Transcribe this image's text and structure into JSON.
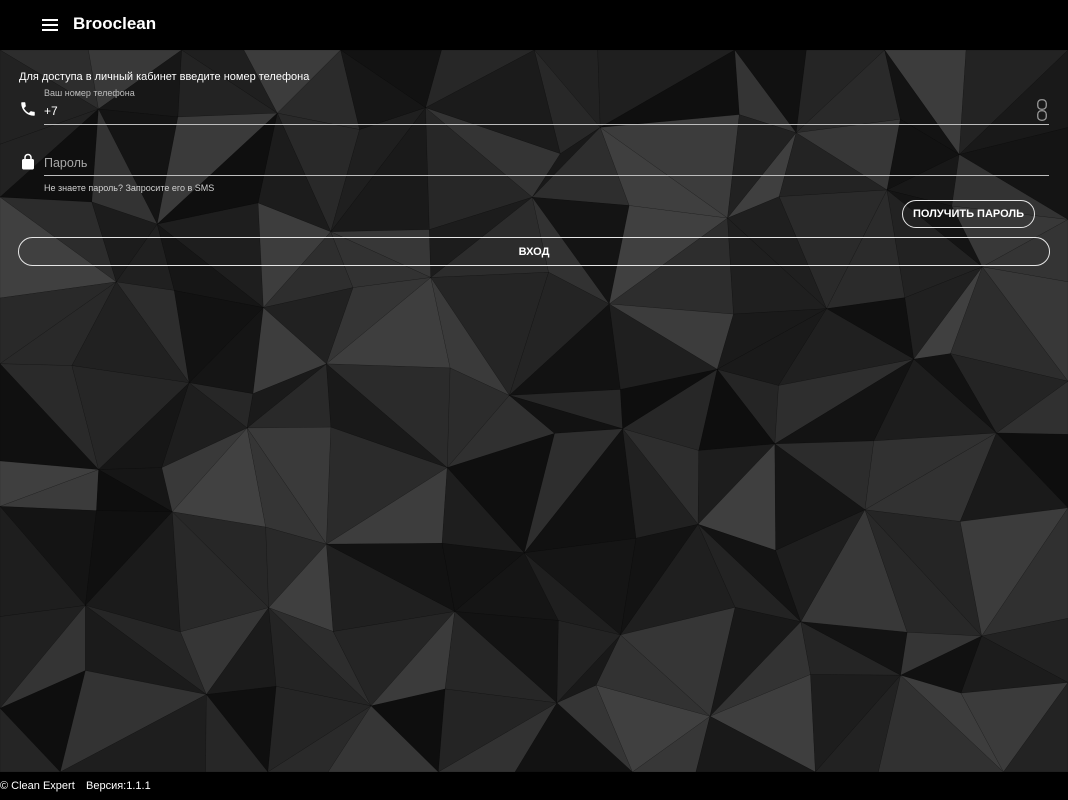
{
  "app": {
    "title": "Brooclean",
    "menu_icon": "menu-icon"
  },
  "login": {
    "intro": "Для доступа в личный кабинет введите номер телефона",
    "phone": {
      "label": "Ваш номер телефона",
      "value": "+7",
      "icon": "phone-icon",
      "trailing_icon": "contacts-icon"
    },
    "password": {
      "placeholder": "Пароль",
      "icon": "lock-icon"
    },
    "hint": "Не знаете пароль? Запросите его в SMS",
    "get_password_label": "ПОЛУЧИТЬ ПАРОЛЬ",
    "login_label": "ВХОД"
  },
  "footer": {
    "copyright": "© Clean Expert",
    "version": "Версия:1.1.1"
  },
  "colors": {
    "header_background": "#000000",
    "background": "#1c1c1c",
    "text": "#ffffff",
    "button_border": "#e6e6e6"
  }
}
